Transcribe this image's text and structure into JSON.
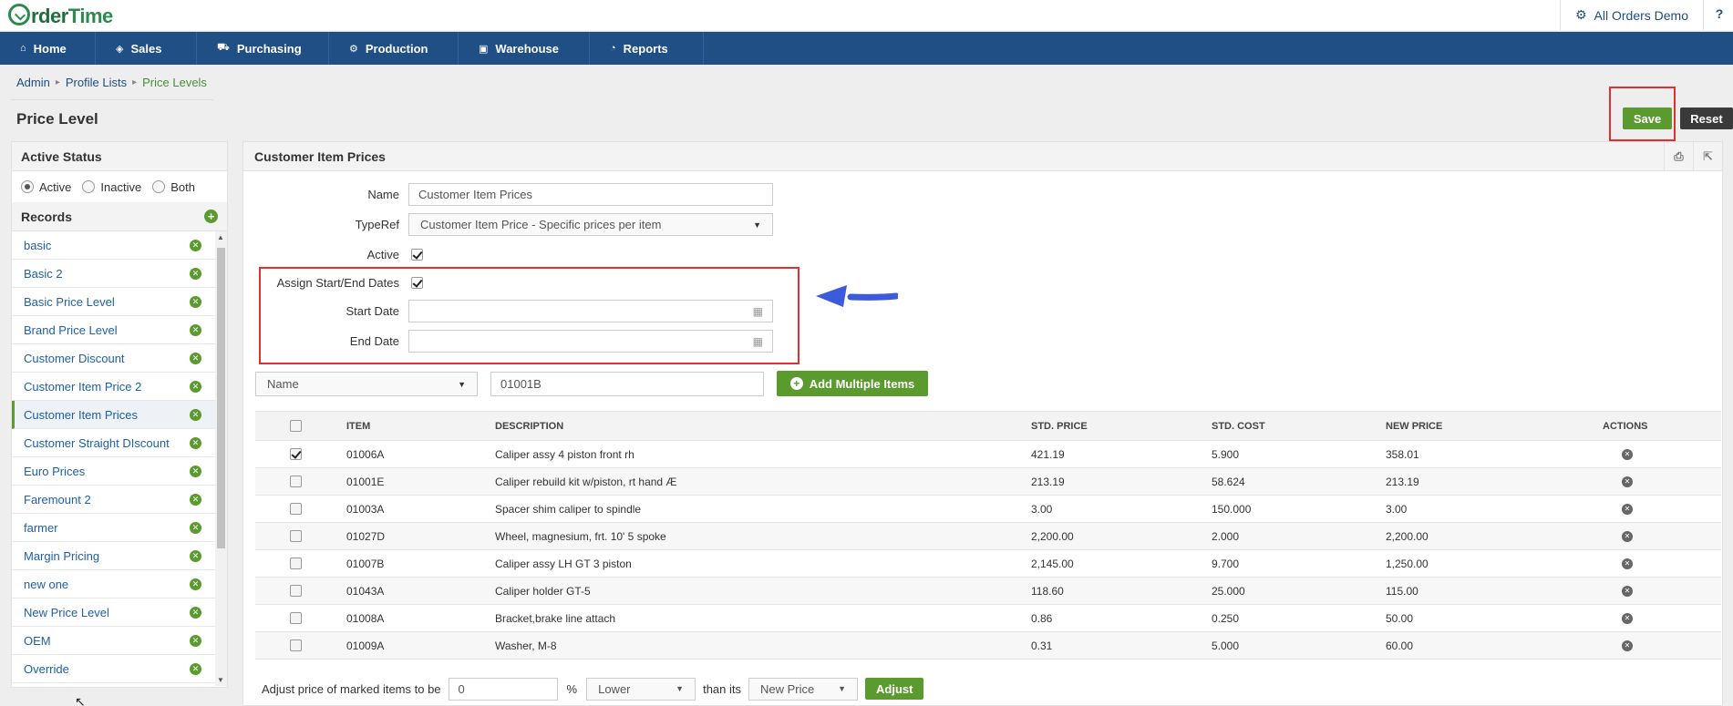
{
  "app": {
    "logo_order": "rder",
    "logo_time": "Time",
    "company": "All Orders Demo",
    "help": "?"
  },
  "nav": [
    {
      "label": "Home",
      "icon": "home-icon",
      "glyph": "⌂"
    },
    {
      "label": "Sales",
      "icon": "tag-icon",
      "glyph": "◈"
    },
    {
      "label": "Purchasing",
      "icon": "cart-icon",
      "glyph": "⛟"
    },
    {
      "label": "Production",
      "icon": "gears-icon",
      "glyph": "⚙"
    },
    {
      "label": "Warehouse",
      "icon": "box-icon",
      "glyph": "▣"
    },
    {
      "label": "Reports",
      "icon": "pie-chart-icon",
      "glyph": "◔"
    }
  ],
  "breadcrumb": [
    "Admin",
    "Profile Lists",
    "Price Levels"
  ],
  "page": {
    "title": "Price Level",
    "save": "Save",
    "reset": "Reset"
  },
  "left": {
    "status_title": "Active Status",
    "status_options": [
      "Active",
      "Inactive",
      "Both"
    ],
    "status_selected": "Active",
    "records_title": "Records",
    "records": [
      "basic",
      "Basic 2",
      "Basic Price Level",
      "Brand Price Level",
      "Customer Discount",
      "Customer Item Price 2",
      "Customer Item Prices",
      "Customer Straight DIscount",
      "Euro Prices",
      "Faremount 2",
      "farmer",
      "Margin Pricing",
      "new one",
      "New Price Level",
      "OEM",
      "Override"
    ],
    "selected_record": "Customer Item Prices"
  },
  "main": {
    "title": "Customer Item Prices",
    "form": {
      "name_label": "Name",
      "name_value": "Customer Item Prices",
      "typeref_label": "TypeRef",
      "typeref_value": "Customer Item Price - Specific prices per item",
      "active_label": "Active",
      "assign_label": "Assign Start/End Dates",
      "start_label": "Start Date",
      "start_value": "",
      "end_label": "End Date",
      "end_value": ""
    },
    "search": {
      "field": "Name",
      "value": "01001B",
      "add_multiple": "Add Multiple Items"
    },
    "table": {
      "headers": [
        "ITEM",
        "DESCRIPTION",
        "STD. PRICE",
        "STD. COST",
        "NEW PRICE",
        "ACTIONS"
      ],
      "rows": [
        {
          "checked": true,
          "item": "01006A",
          "desc": "Caliper assy 4 piston front rh",
          "price": "421.19",
          "cost": "5.900",
          "new": "358.01"
        },
        {
          "checked": false,
          "item": "01001E",
          "desc": "Caliper rebuild kit w/piston, rt hand Æ",
          "price": "213.19",
          "cost": "58.624",
          "new": "213.19"
        },
        {
          "checked": false,
          "item": "01003A",
          "desc": "Spacer shim caliper to spindle",
          "price": "3.00",
          "cost": "150.000",
          "new": "3.00"
        },
        {
          "checked": false,
          "item": "01027D",
          "desc": "Wheel, magnesium, frt. 10' 5 spoke",
          "price": "2,200.00",
          "cost": "2.000",
          "new": "2,200.00"
        },
        {
          "checked": false,
          "item": "01007B",
          "desc": "Caliper assy LH GT 3 piston",
          "price": "2,145.00",
          "cost": "9.700",
          "new": "1,250.00"
        },
        {
          "checked": false,
          "item": "01043A",
          "desc": "Caliper holder GT-5",
          "price": "118.60",
          "cost": "25.000",
          "new": "115.00"
        },
        {
          "checked": false,
          "item": "01008A",
          "desc": "Bracket,brake line attach",
          "price": "0.86",
          "cost": "0.250",
          "new": "50.00"
        },
        {
          "checked": false,
          "item": "01009A",
          "desc": "Washer, M-8",
          "price": "0.31",
          "cost": "5.000",
          "new": "60.00"
        }
      ]
    },
    "adjust": {
      "prefix": "Adjust price of marked items to be",
      "value": "0",
      "percent": "%",
      "direction": "Lower",
      "than": "than its",
      "basis": "New Price",
      "button": "Adjust"
    }
  },
  "colors": {
    "nav": "#1f4f85",
    "accent_green": "#5b9a2e",
    "highlight_red": "#e03030",
    "arrow_blue": "#3b5bdb"
  }
}
